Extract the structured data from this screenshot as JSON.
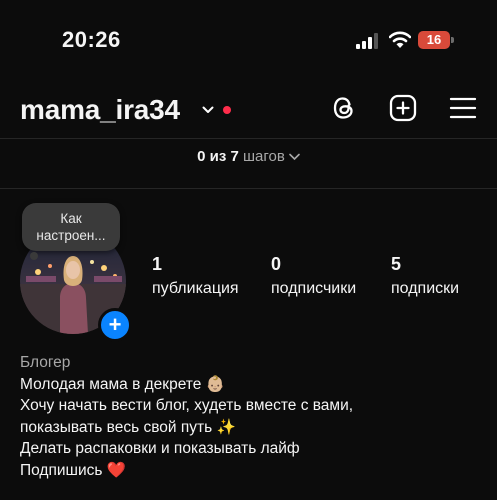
{
  "status_bar": {
    "time": "20:26",
    "battery": "16",
    "icons": [
      "cellular-signal-icon",
      "wifi-icon",
      "battery-icon"
    ],
    "battery_color": "#d94a3a"
  },
  "header": {
    "username": "mama_ira34",
    "icons": [
      "chevron-down-icon",
      "notification-dot",
      "threads-icon",
      "create-plus-icon",
      "menu-icon"
    ],
    "dot_color": "#ff2d4b"
  },
  "steps": {
    "progress": "0 из 7",
    "label": "шагов",
    "completed_steps": 0,
    "total_steps": 7
  },
  "note": {
    "text_line1": "Как",
    "text_line2": "настроен..."
  },
  "stats": [
    {
      "count": "1",
      "label": "публикация"
    },
    {
      "count": "0",
      "label": "подписчики"
    },
    {
      "count": "5",
      "label": "подписки"
    }
  ],
  "bio": {
    "category": "Блогер",
    "line1": "Молодая мама в декрете 👶🏼",
    "line2": "Хочу начать вести блог, худеть вместе с вами,",
    "line3": "показывать весь свой путь ✨",
    "line4": "Делать распаковки и показывать лайф",
    "line5": "Подпишись ❤️"
  },
  "colors": {
    "background": "#0c0c0c",
    "accent_blue": "#0a84ff",
    "muted_text": "#a8a8a8"
  }
}
